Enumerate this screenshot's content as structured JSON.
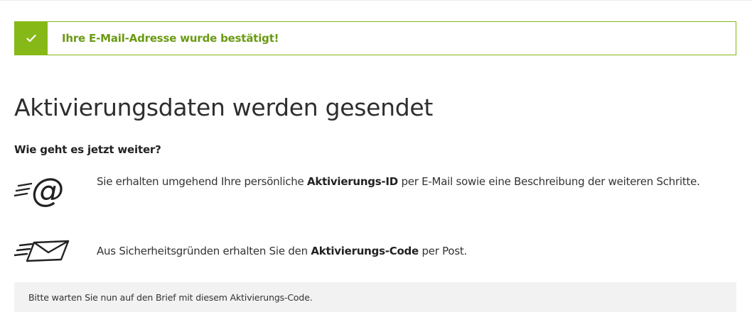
{
  "alert": {
    "icon": "checkmark-icon",
    "message": "Ihre E-Mail-Adresse wurde bestätigt!",
    "accent_color": "#86b817",
    "text_color": "#6a9a12"
  },
  "title": "Aktivierungsdaten werden gesendet",
  "subheading": "Wie geht es jetzt weiter?",
  "steps": [
    {
      "icon": "email-at-icon",
      "text_before": "Sie erhalten umgehend Ihre persönliche ",
      "bold": "Aktivierungs-ID",
      "text_after": " per E-Mail sowie eine Beschreibung der weiteren Schritte."
    },
    {
      "icon": "envelope-icon",
      "text_before": "Aus Sicherheitsgründen erhalten Sie den ",
      "bold": "Aktivierungs-Code",
      "text_after": " per Post."
    }
  ],
  "note": "Bitte warten Sie nun auf den Brief mit diesem Aktivierungs-Code."
}
